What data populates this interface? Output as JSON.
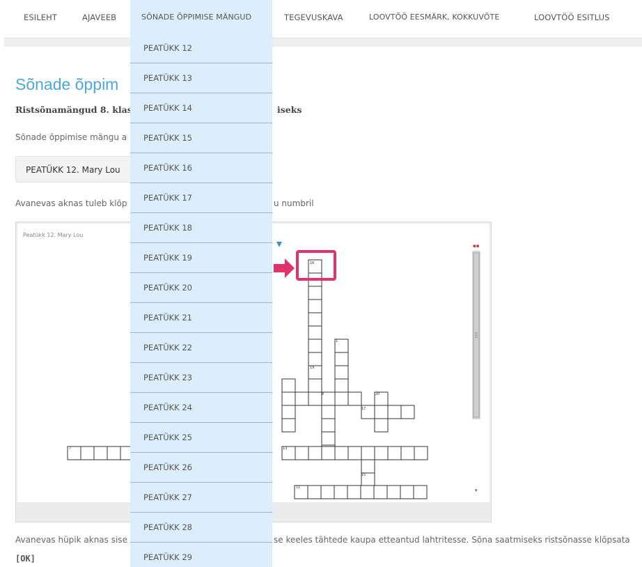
{
  "nav": {
    "items": [
      {
        "label": "ESILEHT"
      },
      {
        "label": "AJAVEEB"
      },
      {
        "label": "SÕNADE ÕPPIMISE MÄNGUD"
      },
      {
        "label": "TEGEVUSKAVA"
      },
      {
        "label": "LOOVTÖÖ EESMÄRK, KOKKUVÕTE"
      },
      {
        "label": "LOOVTÖÖ ESITLUS"
      }
    ]
  },
  "dropdown": {
    "items": [
      {
        "label": "PEATÜKK 12"
      },
      {
        "label": "PEATÜKK 13"
      },
      {
        "label": "PEATÜKK 14"
      },
      {
        "label": "PEATÜKK 15"
      },
      {
        "label": "PEATÜKK 16"
      },
      {
        "label": "PEATÜKK 17"
      },
      {
        "label": "PEATÜKK 18"
      },
      {
        "label": "PEATÜKK 19"
      },
      {
        "label": "PEATÜKK 20"
      },
      {
        "label": "PEATÜKK 21"
      },
      {
        "label": "PEATÜKK 22"
      },
      {
        "label": "PEATÜKK 23"
      },
      {
        "label": "PEATÜKK 24"
      },
      {
        "label": "PEATÜKK 25"
      },
      {
        "label": "PEATÜKK 26"
      },
      {
        "label": "PEATÜKK 27"
      },
      {
        "label": "PEATÜKK 28"
      },
      {
        "label": "PEATÜKK 29"
      }
    ]
  },
  "content": {
    "title": "Sõnade õppim",
    "subtitle_left": "Ristsõnamängud 8. klas",
    "subtitle_right": "iseks",
    "intro": "Sõnade õppimise mängu a",
    "chapter_button": "PEATÜKK 12. Mary Lou",
    "instruction_left": "Avanevas aknas tuleb klõp",
    "instruction_right": "u numbril",
    "screenshot_caption": "Peatükk 12. Mary Lou",
    "bottom_left": "Avanevas hüpik aknas sise",
    "bottom_right": "se keeles tähtede kaupa etteantud lahtritesse. Sõna saatmiseks ristsõnasse klõpsata",
    "ok": "[OK]"
  },
  "crossword_numbers": {
    "n16": "16",
    "n1": "1",
    "n19": "19",
    "n8": "8",
    "n20": "20",
    "n17": "17",
    "n7": "7",
    "n13": "13",
    "n15": "15",
    "n11": "11"
  },
  "colors": {
    "accent": "#4ea7dc",
    "dropdown_bg": "#dceefb",
    "highlight": "#e0336b"
  }
}
